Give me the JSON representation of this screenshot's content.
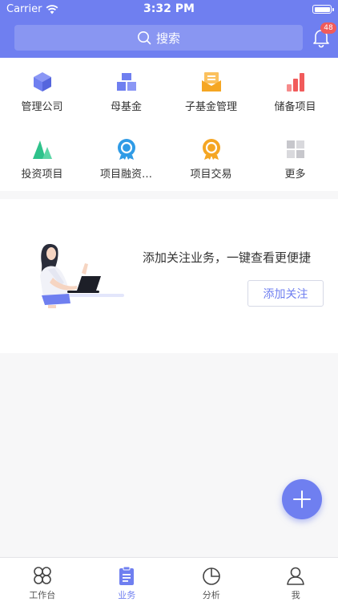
{
  "status_bar": {
    "carrier": "Carrier",
    "time": "3:32 PM"
  },
  "header": {
    "search_placeholder": "搜索",
    "notification_count": "48"
  },
  "grid": [
    {
      "label": "管理公司",
      "icon": "cube-icon",
      "color": "#6f7ff0"
    },
    {
      "label": "母基金",
      "icon": "blocks-icon",
      "color": "#6f7ff0"
    },
    {
      "label": "子基金管理",
      "icon": "envelope-icon",
      "color": "#f5a623"
    },
    {
      "label": "储备项目",
      "icon": "bar-chart-icon",
      "color": "#f15b5b"
    },
    {
      "label": "投资项目",
      "icon": "mountain-icon",
      "color": "#2ec28b"
    },
    {
      "label": "项目融资…",
      "icon": "medal-icon",
      "color": "#2f9be6"
    },
    {
      "label": "项目交易",
      "icon": "award-icon",
      "color": "#f5a623"
    },
    {
      "label": "更多",
      "icon": "more-grid-icon",
      "color": "#c7c7cc"
    }
  ],
  "follow": {
    "message": "添加关注业务，一键查看更便捷",
    "button_label": "添加关注"
  },
  "tabbar": [
    {
      "label": "工作台",
      "icon": "workbench-icon",
      "active": false
    },
    {
      "label": "业务",
      "icon": "clipboard-icon",
      "active": true
    },
    {
      "label": "分析",
      "icon": "pie-chart-icon",
      "active": false
    },
    {
      "label": "我",
      "icon": "user-icon",
      "active": false
    }
  ],
  "colors": {
    "primary": "#6f7ff0",
    "badge": "#f15b5b"
  }
}
